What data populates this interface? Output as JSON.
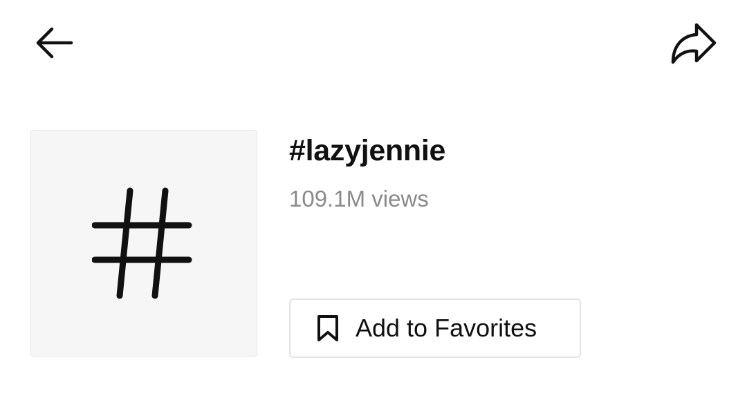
{
  "header": {
    "back_icon": "arrow-left-icon",
    "share_icon": "share-arrow-icon"
  },
  "hashtag": {
    "icon": "hashtag-icon",
    "title": "#lazyjennie",
    "views": "109.1M views"
  },
  "actions": {
    "favorite_icon": "bookmark-icon",
    "favorite_label": "Add to Favorites"
  }
}
